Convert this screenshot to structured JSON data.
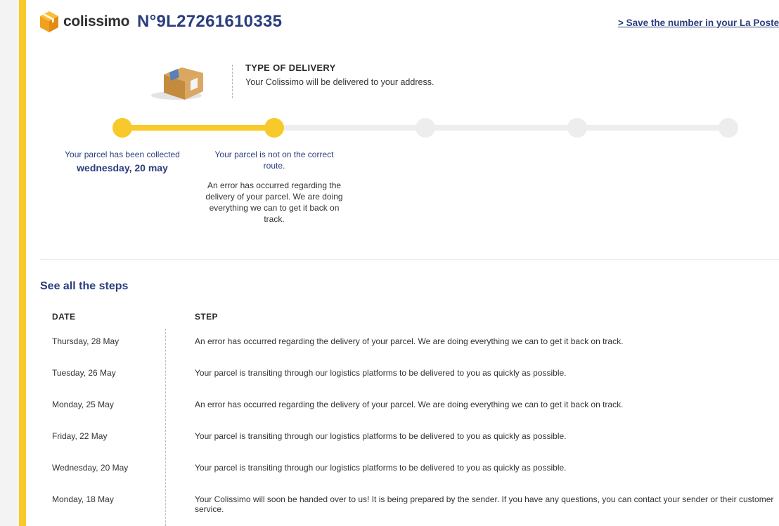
{
  "header": {
    "logo_text": "colissimo",
    "tracking_number": "N°9L27261610335",
    "save_link": "> Save the number in your La Poste a"
  },
  "delivery_type": {
    "title": "TYPE OF DELIVERY",
    "description": "Your Colissimo will be delivered to your address."
  },
  "progress": {
    "steps": [
      {
        "label": "Your parcel has been collected",
        "date": "wednesday, 20 may",
        "note": ""
      },
      {
        "label": "Your parcel is not on the correct route.",
        "date": "",
        "note": "An error has occurred regarding the delivery of your parcel. We are doing everything we can to get it back on track."
      }
    ],
    "completed_steps": 2,
    "total_steps": 5
  },
  "steps_table": {
    "heading": "See all the steps",
    "col_date": "DATE",
    "col_step": "STEP",
    "rows": [
      {
        "date": "Thursday, 28 May",
        "step": "An error has occurred regarding the delivery of your parcel. We are doing everything we can to get it back on track."
      },
      {
        "date": "Tuesday, 26 May",
        "step": "Your parcel is transiting through our logistics platforms to be delivered to you as quickly as possible."
      },
      {
        "date": "Monday, 25 May",
        "step": "An error has occurred regarding the delivery of your parcel. We are doing everything we can to get it back on track."
      },
      {
        "date": "Friday, 22 May",
        "step": "Your parcel is transiting through our logistics platforms to be delivered to you as quickly as possible."
      },
      {
        "date": "Wednesday, 20 May",
        "step": "Your parcel is transiting through our logistics platforms to be delivered to you as quickly as possible."
      },
      {
        "date": "Monday, 18 May",
        "step": "Your Colissimo will soon be handed over to us! It is being prepared by the sender. If you have any questions, you can contact your sender or their customer service."
      }
    ]
  },
  "colors": {
    "brand_yellow": "#f8c92b",
    "brand_blue": "#2a3e7e",
    "inactive_gray": "#eeeeee"
  },
  "icons": {
    "logo": "colissimo-box-logo-icon",
    "delivery": "parcel-box-icon"
  }
}
